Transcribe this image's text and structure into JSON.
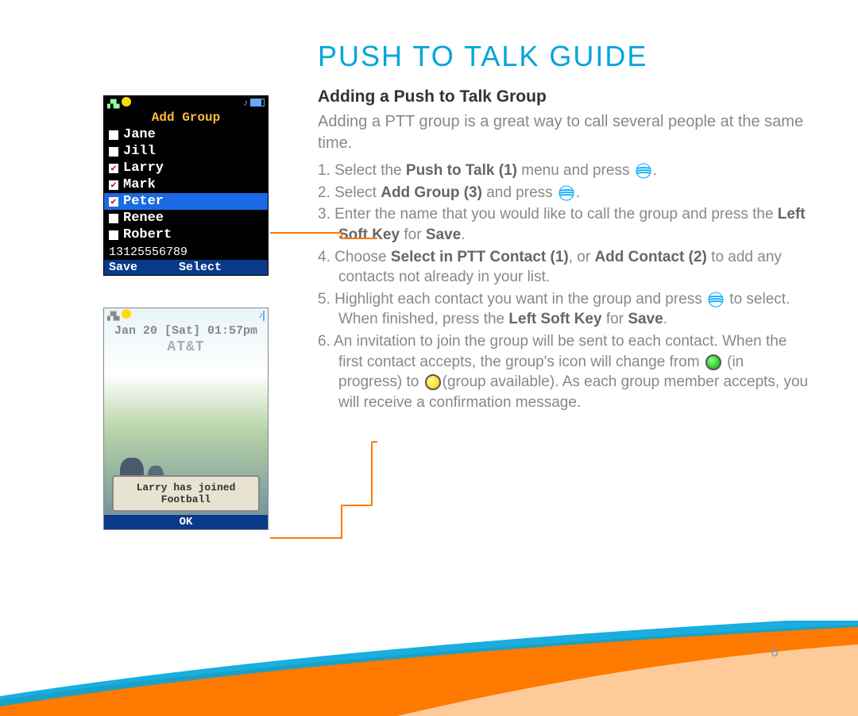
{
  "title": "PUSH TO TALK GUIDE",
  "subtitle": "Adding a Push to Talk Group",
  "intro": "Adding a PTT group is a great way to call several people at the same time.",
  "steps": {
    "s1a": "1. Select the ",
    "s1b": "Push to Talk (1)",
    "s1c": " menu and press ",
    "s1d": ".",
    "s2a": "2. Select ",
    "s2b": "Add Group (3)",
    "s2c": " and press ",
    "s2d": ".",
    "s3a": "3. Enter the name that you would like to call the group and press the ",
    "s3b": "Left Soft Key",
    "s3c": " for ",
    "s3d": "Save",
    "s3e": ".",
    "s4a": "4. Choose ",
    "s4b": "Select in PTT Contact (1)",
    "s4c": ", or ",
    "s4d": "Add Contact (2)",
    "s4e": " to add any contacts not already in your list.",
    "s5a": "5. Highlight each contact you want in the group and press ",
    "s5b": " to select. When finished, press the ",
    "s5c": "Left Soft Key",
    "s5d": " for ",
    "s5e": "Save",
    "s5f": ".",
    "s6a": "6. An invitation to join the group will be sent to each contact. When the first contact accepts, the group's icon will change from ",
    "s6b": " (in progress) to ",
    "s6c": "(group available). As each group member accepts, you will receive a confirmation message."
  },
  "phone1": {
    "title": "Add Group",
    "contacts": [
      "Jane",
      "Jill",
      "Larry",
      "Mark",
      "Peter",
      "Renee",
      "Robert"
    ],
    "number": "13125556789",
    "soft_left": "Save",
    "soft_mid": "Select"
  },
  "phone2": {
    "datetime": "Jan 20 [Sat] 01:57pm",
    "brand": "AT&T",
    "popup_line1": "Larry has joined",
    "popup_line2": "Football",
    "soft_mid": "OK"
  },
  "page_number": "6"
}
